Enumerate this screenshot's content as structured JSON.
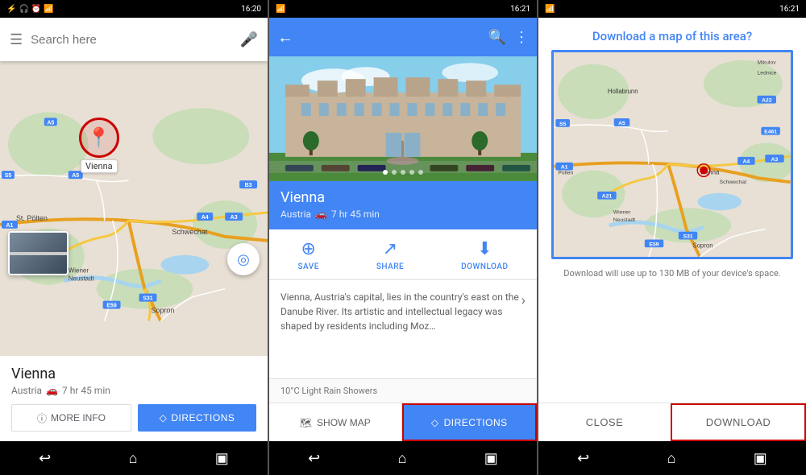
{
  "screen1": {
    "status_bar": {
      "time": "16:20",
      "left_icons": [
        "bluetooth",
        "headset",
        "alarm",
        "signal"
      ]
    },
    "search_placeholder": "Search here",
    "city_label": "Vienna",
    "schwechat_label": "Schwechat",
    "wiener_neustadt_label": "Wiener\nNeustadt",
    "sopron_label": "Sopron",
    "bottom_card": {
      "title": "Vienna",
      "subtitle": "Austria",
      "drive_time": "7 hr 45 min",
      "more_info_label": "MORE INFO",
      "directions_label": "DIRECTIONS"
    },
    "nav": {
      "back": "↩",
      "home": "⌂",
      "recents": "▣"
    }
  },
  "screen2": {
    "status_bar": {
      "time": "16:21"
    },
    "place_name": "Vienna",
    "place_subtitle": "Austria",
    "drive_time": "7 hr 45 min",
    "image_dots": 5,
    "actions": [
      {
        "icon": "bookmark-plus",
        "label": "SAVE"
      },
      {
        "icon": "share",
        "label": "SHARE"
      },
      {
        "icon": "download",
        "label": "DOWNLOAD"
      }
    ],
    "description": "Vienna, Austria's capital, lies in the country's east on the Danube River. Its artistic and intellectual legacy was shaped by residents including Moz…",
    "weather": "10°C Light Rain Showers",
    "show_map_label": "SHOW MAP",
    "directions_label": "DIRECTIONS"
  },
  "screen3": {
    "status_bar": {
      "time": "16:21"
    },
    "title": "Download a map of this area?",
    "download_info": "Download will use up to 130 MB of your device's space.",
    "close_label": "CLOSE",
    "download_label": "DOWNLOAD",
    "map_labels": {
      "hollabrunn": "Hollabrunn",
      "vienna": "Vienna",
      "schwechat": "Schwechat",
      "wiener_neustadt": "Wiener\nNeustadt",
      "mikulov": "Mikulov",
      "lednice": "Lednice",
      "pollen": "Pollen"
    }
  }
}
